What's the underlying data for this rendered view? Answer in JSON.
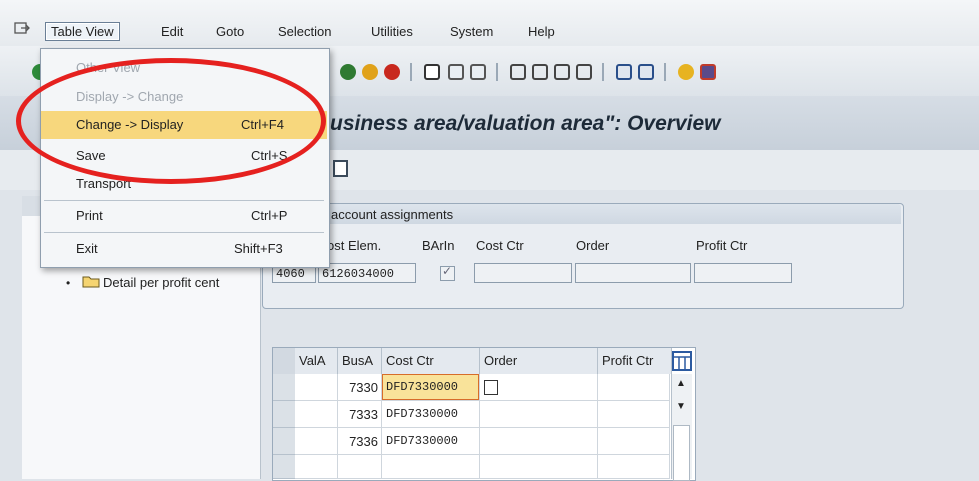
{
  "menubar": {
    "items": [
      "Table View",
      "Edit",
      "Goto",
      "Selection",
      "Utilities",
      "System",
      "Help"
    ]
  },
  "title": "usiness area/valuation area\": Overview",
  "left_tree": {
    "item": "Detail per profit cent"
  },
  "frame": {
    "title": "account assignments",
    "col_cost_elem": "ost Elem.",
    "col_barin": "BArIn",
    "col_cost_ctr": "Cost Ctr",
    "col_order": "Order",
    "col_profit_ctr": "Profit Ctr",
    "val_prefix": "4060",
    "val_cost_elem": "6126034000"
  },
  "table": {
    "headers": [
      "ValA",
      "BusA",
      "Cost Ctr",
      "Order",
      "Profit Ctr"
    ],
    "rows": [
      {
        "busa": "7330",
        "cost_ctr": "DFD7330000"
      },
      {
        "busa": "7333",
        "cost_ctr": "DFD7330000"
      },
      {
        "busa": "7336",
        "cost_ctr": "DFD7330000"
      }
    ]
  },
  "dropdown": {
    "items": [
      {
        "label": "Other View",
        "shortcut": ""
      },
      {
        "label": "Display -> Change",
        "shortcut": ""
      },
      {
        "label": "Change -> Display",
        "shortcut": "Ctrl+F4"
      },
      {
        "label": "Save",
        "shortcut": "Ctrl+S"
      },
      {
        "label": "Transport",
        "shortcut": ""
      },
      {
        "label": "Print",
        "shortcut": "Ctrl+P"
      },
      {
        "label": "Exit",
        "shortcut": "Shift+F3"
      }
    ]
  },
  "colors": {
    "highlight": "#f7d77d",
    "annotation_ring": "#e5211f"
  }
}
